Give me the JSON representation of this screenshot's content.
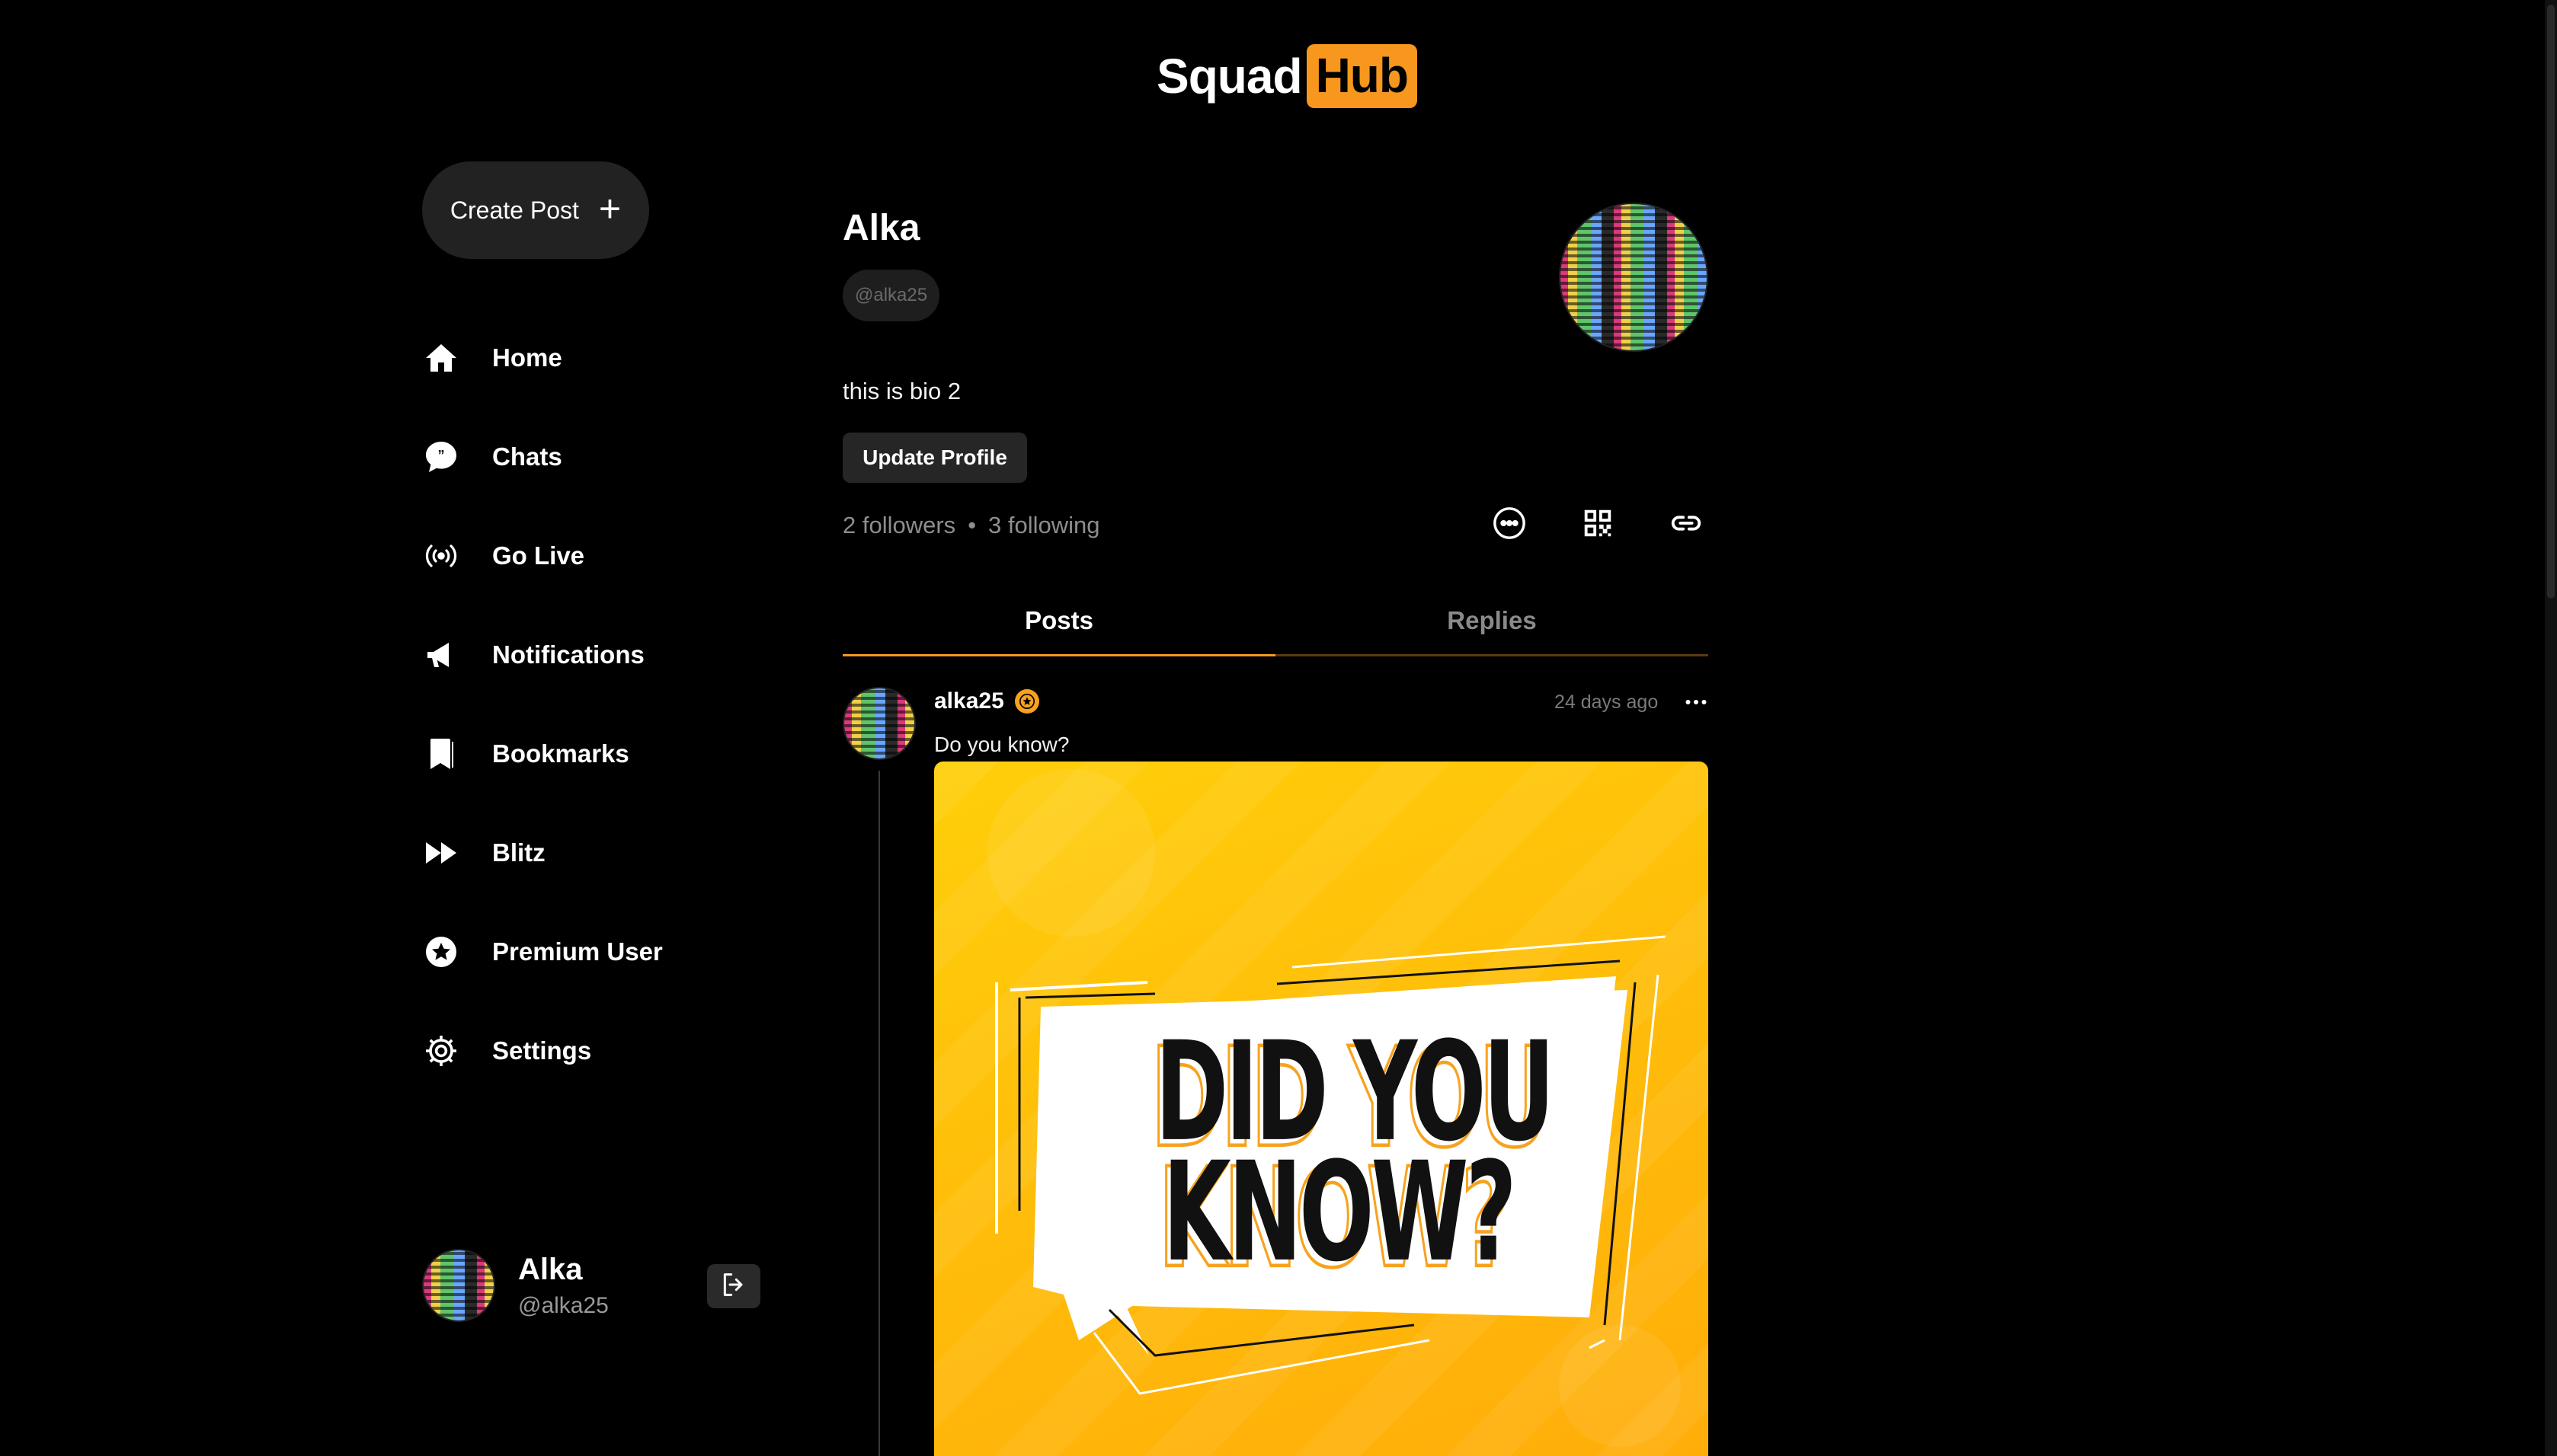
{
  "logo": {
    "part1": "Squad",
    "part2": "Hub"
  },
  "sidebar": {
    "create_post_label": "Create Post",
    "items": [
      {
        "label": "Home",
        "icon": "home-icon"
      },
      {
        "label": "Chats",
        "icon": "chat-icon"
      },
      {
        "label": "Go Live",
        "icon": "broadcast-icon"
      },
      {
        "label": "Notifications",
        "icon": "megaphone-icon"
      },
      {
        "label": "Bookmarks",
        "icon": "bookmark-icon"
      },
      {
        "label": "Blitz",
        "icon": "fast-forward-icon"
      },
      {
        "label": "Premium User",
        "icon": "star-badge-icon"
      },
      {
        "label": "Settings",
        "icon": "gear-icon"
      }
    ],
    "user": {
      "name": "Alka",
      "handle": "@alka25"
    }
  },
  "profile": {
    "name": "Alka",
    "handle": "@alka25",
    "bio": "this is bio 2",
    "update_label": "Update Profile",
    "followers": "2 followers",
    "separator": "•",
    "following": "3 following"
  },
  "tabs": [
    {
      "label": "Posts",
      "active": true
    },
    {
      "label": "Replies",
      "active": false
    }
  ],
  "post": {
    "username": "alka25",
    "time": "24 days ago",
    "text": "Do you know?",
    "image_text_1": "DID YOU",
    "image_text_2": "KNOW?"
  },
  "colors": {
    "accent": "#f7971e",
    "background": "#000000",
    "image_bg": "#ffbe0a"
  }
}
